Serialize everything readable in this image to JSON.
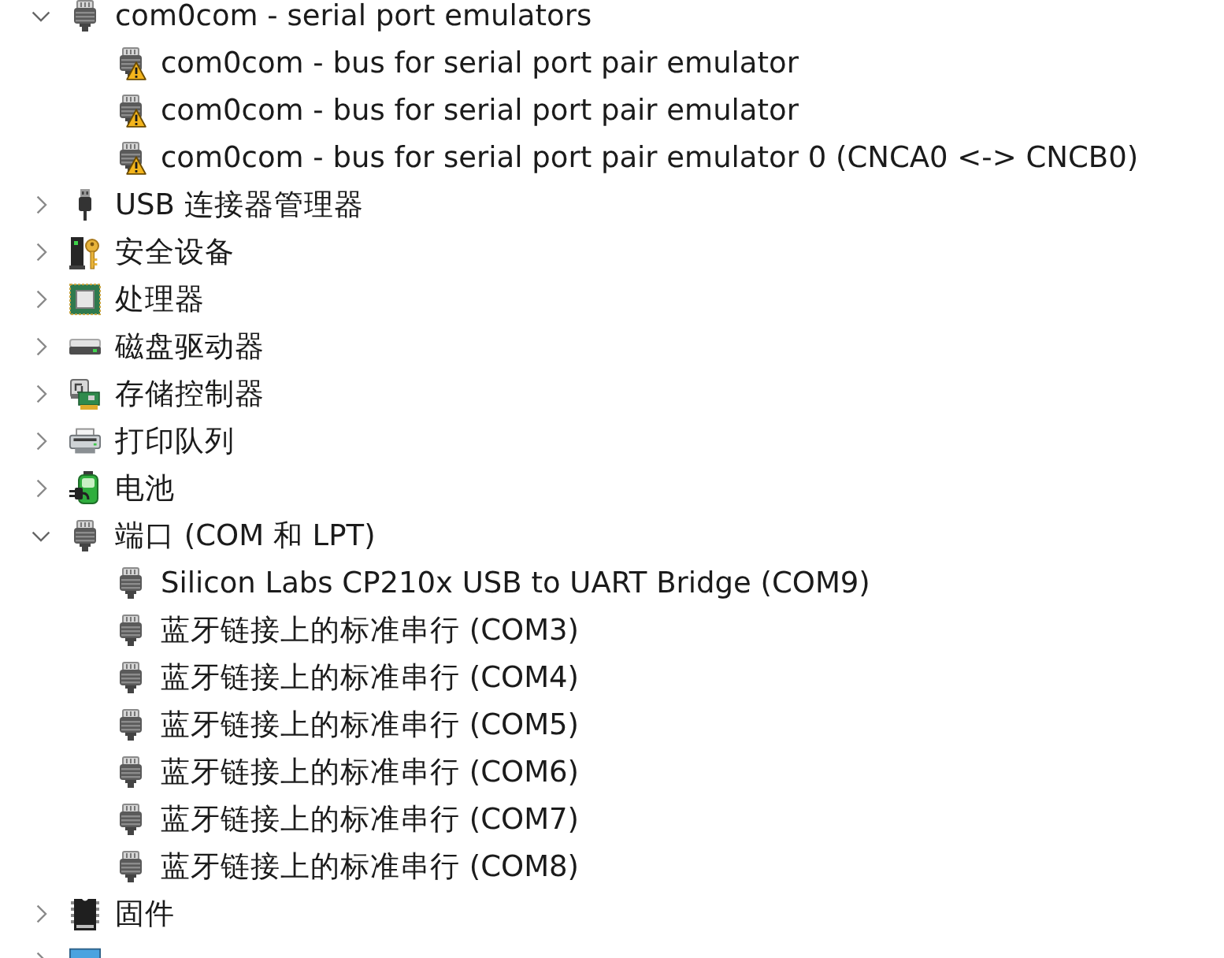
{
  "tree": [
    {
      "label": "com0com - serial port emulators",
      "kind": "port",
      "expanded": true,
      "children": [
        {
          "label": "com0com - bus for serial port pair emulator",
          "kind": "port",
          "warning": true
        },
        {
          "label": "com0com - bus for serial port pair emulator",
          "kind": "port",
          "warning": true
        },
        {
          "label": "com0com - bus for serial port pair emulator 0 (CNCA0 <-> CNCB0)",
          "kind": "port",
          "warning": true
        }
      ]
    },
    {
      "label": "USB 连接器管理器",
      "kind": "usb",
      "expanded": false
    },
    {
      "label": "安全设备",
      "kind": "security",
      "expanded": false
    },
    {
      "label": "处理器",
      "kind": "processor",
      "expanded": false
    },
    {
      "label": "磁盘驱动器",
      "kind": "disk",
      "expanded": false
    },
    {
      "label": "存储控制器",
      "kind": "storage",
      "expanded": false
    },
    {
      "label": "打印队列",
      "kind": "printer",
      "expanded": false
    },
    {
      "label": "电池",
      "kind": "battery",
      "expanded": false
    },
    {
      "label": "端口 (COM 和 LPT)",
      "kind": "port",
      "expanded": true,
      "children": [
        {
          "label": "Silicon Labs CP210x USB to UART Bridge (COM9)",
          "kind": "port",
          "warning": false
        },
        {
          "label": "蓝牙链接上的标准串行 (COM3)",
          "kind": "port",
          "warning": false
        },
        {
          "label": "蓝牙链接上的标准串行 (COM4)",
          "kind": "port",
          "warning": false
        },
        {
          "label": "蓝牙链接上的标准串行 (COM5)",
          "kind": "port",
          "warning": false
        },
        {
          "label": "蓝牙链接上的标准串行 (COM6)",
          "kind": "port",
          "warning": false
        },
        {
          "label": "蓝牙链接上的标准串行 (COM7)",
          "kind": "port",
          "warning": false
        },
        {
          "label": "蓝牙链接上的标准串行 (COM8)",
          "kind": "port",
          "warning": false
        }
      ]
    },
    {
      "label": "固件",
      "kind": "firmware",
      "expanded": false
    },
    {
      "kind": "computer",
      "expanded": false
    }
  ]
}
